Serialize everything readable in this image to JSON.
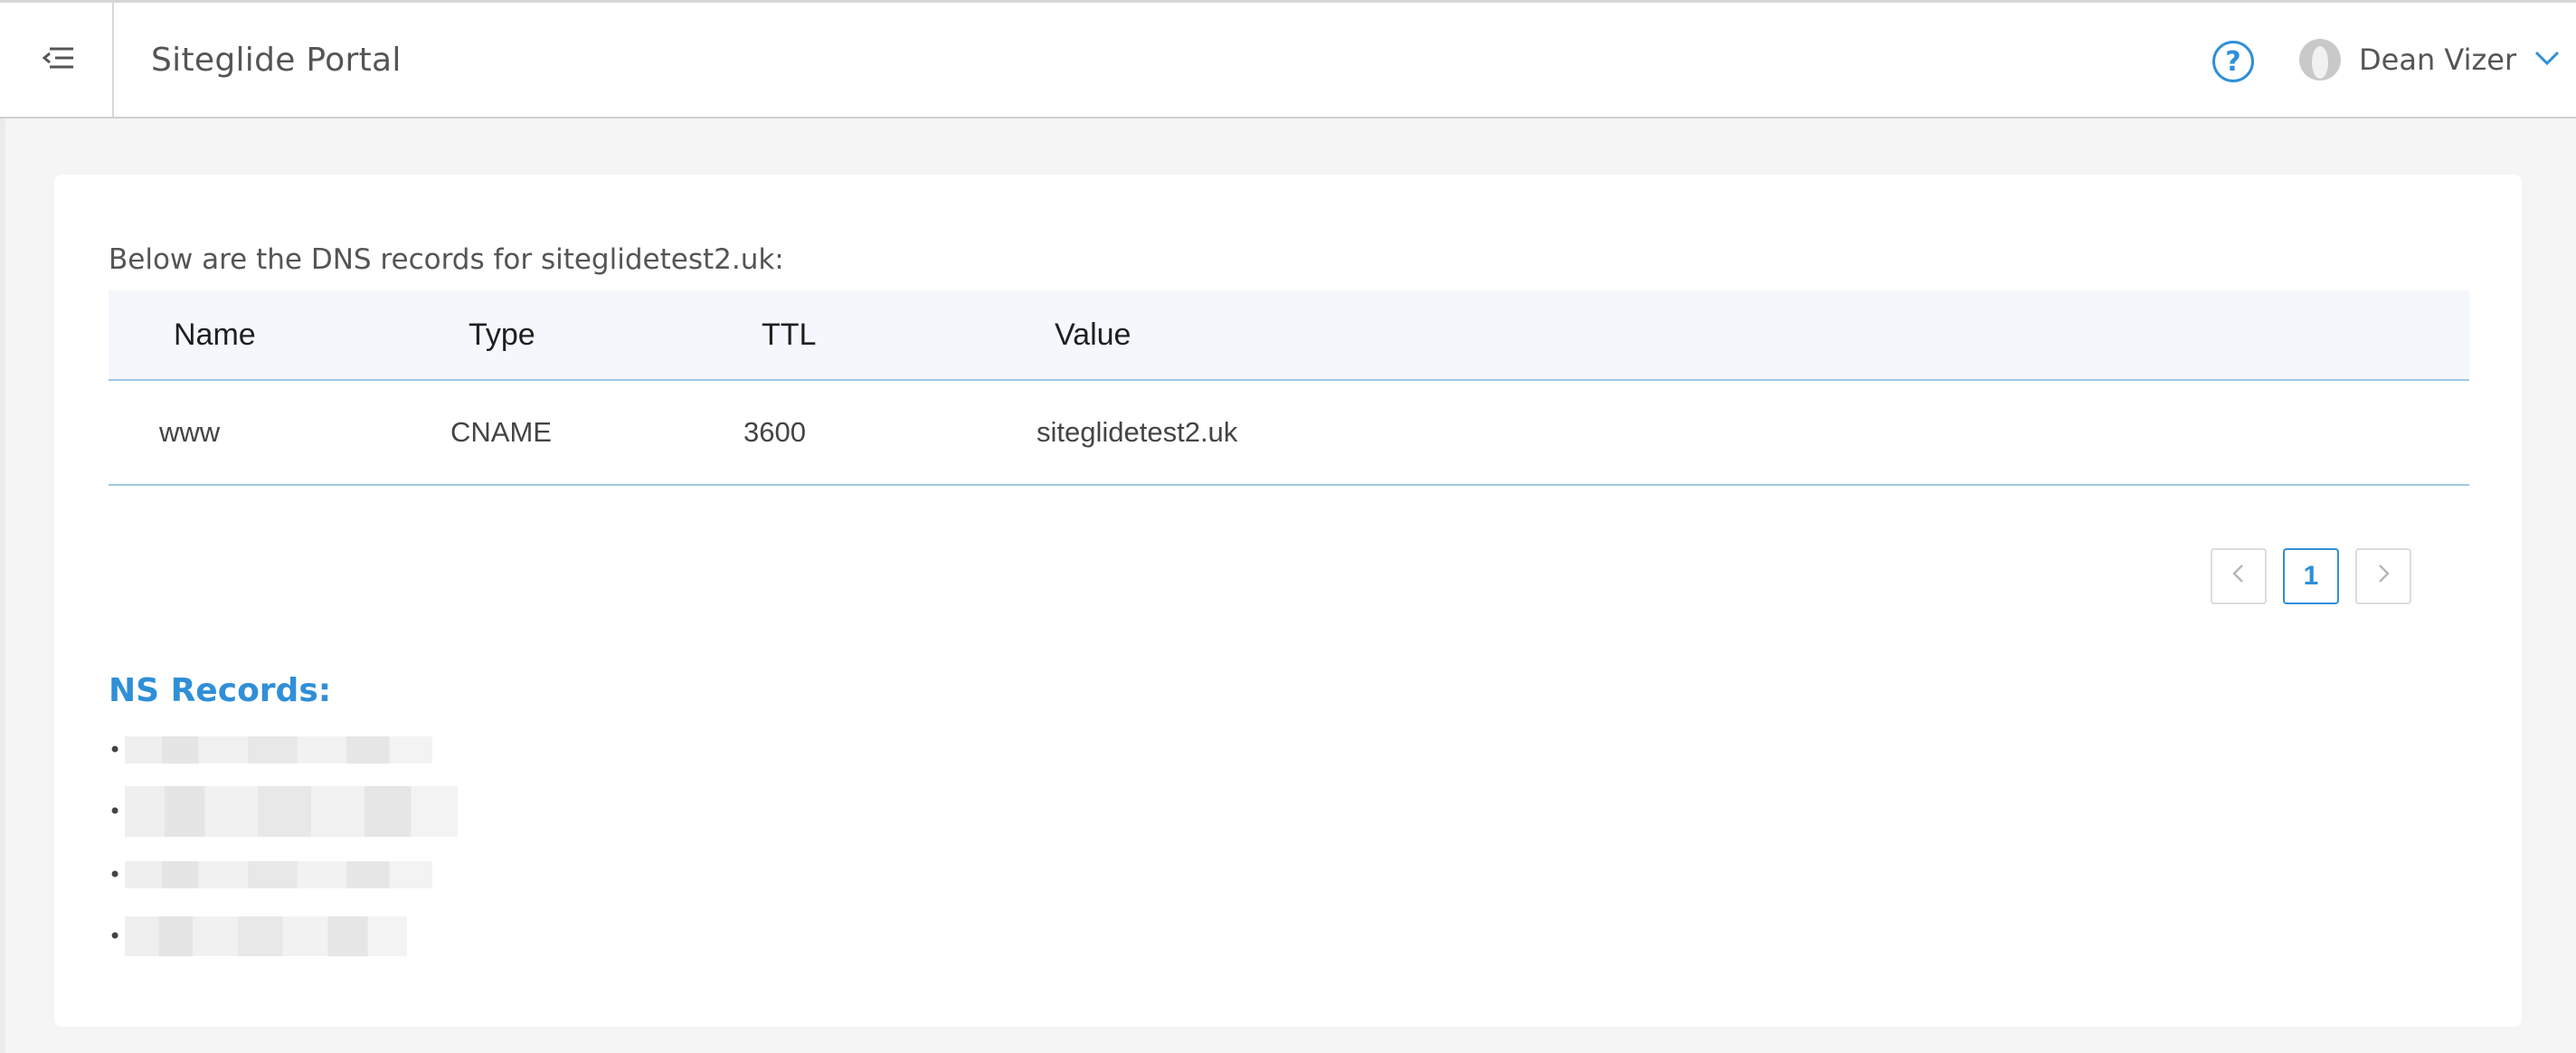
{
  "header": {
    "title": "Siteglide Portal",
    "menu_icon": "menu-collapse-icon",
    "help_icon": "help-icon",
    "help_glyph": "?",
    "user_name": "Dean Vizer",
    "user_menu_icon": "chevron-down-icon"
  },
  "main": {
    "intro_text": "Below are the DNS records for siteglidetest2.uk:",
    "table": {
      "columns": [
        "Name",
        "Type",
        "TTL",
        "Value"
      ],
      "rows": [
        [
          "www",
          "CNAME",
          "3600",
          "siteglidetest2.uk"
        ]
      ]
    },
    "pagination": {
      "current_page": "1",
      "prev_icon": "chevron-left-icon",
      "next_icon": "chevron-right-icon"
    },
    "ns_records_title": "NS Records:"
  },
  "colors": {
    "accent": "#2f8fd8",
    "table_header_bg": "#f4f8fc",
    "table_rule": "#9dc9e4"
  }
}
